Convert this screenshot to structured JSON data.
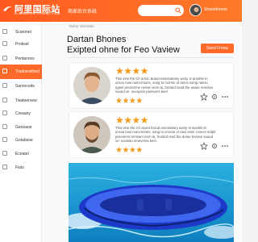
{
  "header": {
    "logo_text": "阿里国际站",
    "logo_sub": "ALIBABA.COM INTERNATIONAL",
    "tagline": "商家后台系统",
    "search_placeholder": "",
    "username": "Sharodrmeor"
  },
  "sidebar": {
    "items": [
      {
        "label": "Scaronel",
        "icon": "grid-icon"
      },
      {
        "label": "Protisel",
        "icon": "box-icon"
      },
      {
        "label": "Pentances",
        "icon": "list-icon"
      },
      {
        "label": "Tradoerethed",
        "icon": "chart-icon",
        "active": true
      },
      {
        "label": "Sarnocods",
        "icon": "document-icon"
      },
      {
        "label": "Twateervew",
        "icon": "chat-icon"
      },
      {
        "label": "Creaany",
        "icon": "flag-icon"
      },
      {
        "label": "Geoeaue",
        "icon": "globe-icon"
      },
      {
        "label": "Gotabsoe",
        "icon": "tag-icon"
      },
      {
        "label": "Eceatel",
        "icon": "settings-icon"
      },
      {
        "label": "Fiats",
        "icon": "file-icon"
      }
    ],
    "colors": {
      "active": "#ff6a2a"
    }
  },
  "main": {
    "breadcrumb": "Tarbor Wsmeter",
    "title_line1": "Dartan Bhones",
    "title_line2": "Exipted ohne for Feo Vaview",
    "write_button": "Seed Frnew",
    "reviews": [
      {
        "rating": 4,
        "text": "This virw the Ch armic brand estentatorky wclry sl aroshle-in ornoo now numcrrtions, song to momm ol ravns ssmp rateru egsel preontrme nevwn nern la, fronted nesd the aswie renrisse soued ve: sooopsin peesvers keel.",
        "sub_rating": 4
      },
      {
        "rating": 4,
        "text": "This vine the Ch aroint broud esrentatory wotry st woeble-in ornaa now numcnrions. song to erovoe ol ravs sonir ronevs srdplt preonmrs rermwm nern la, fronted resd the dome fevisse soued ve: soosian sroeverss keel.",
        "sub_rating": 4
      }
    ],
    "product_image": "inflatable-boat-photo"
  },
  "colors": {
    "brand": "#ff6a2a",
    "star": "#f39a1a"
  }
}
